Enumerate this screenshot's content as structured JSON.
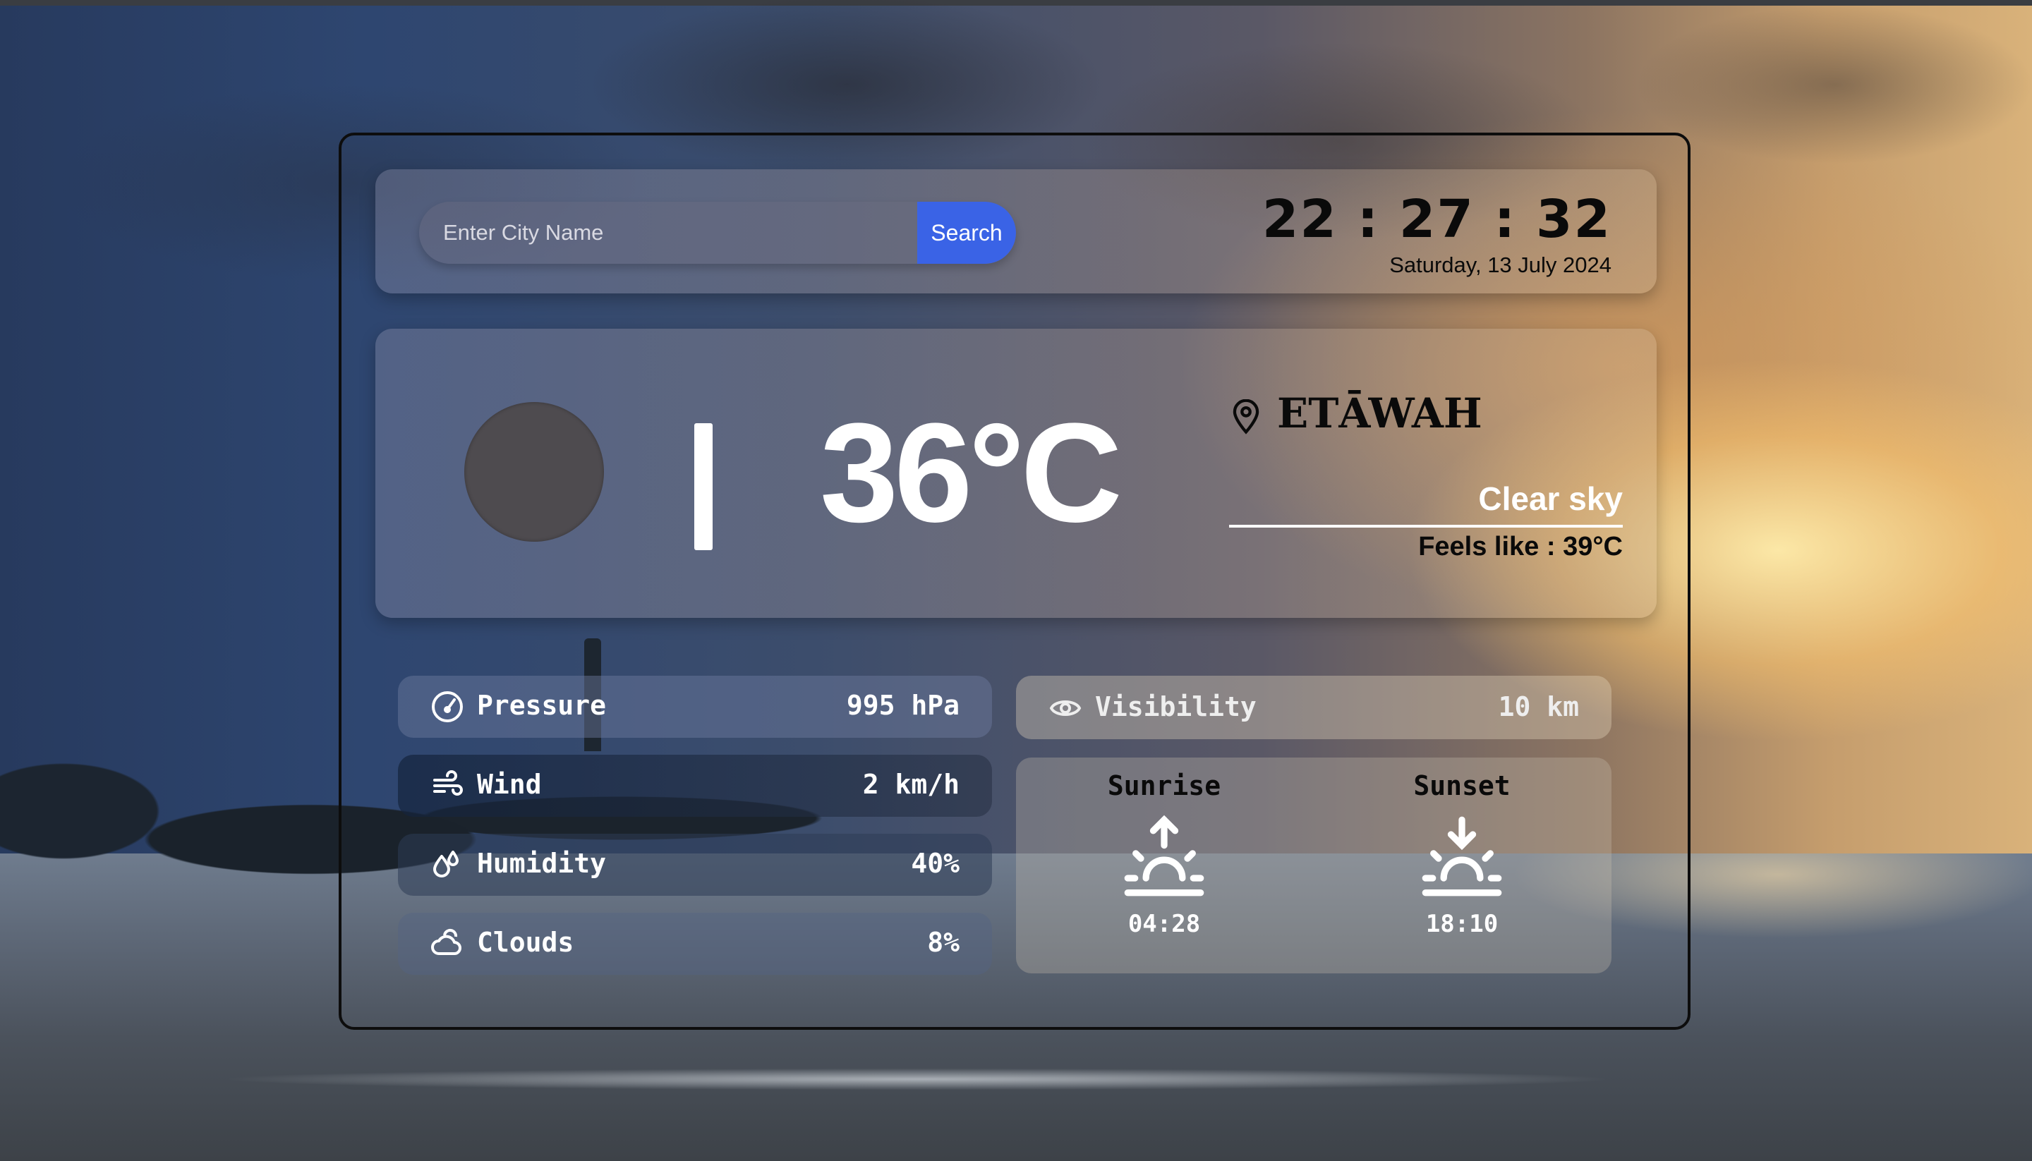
{
  "search": {
    "placeholder": "Enter City Name",
    "button_label": "Search"
  },
  "clock": {
    "time": "22 : 27 : 32",
    "date": "Saturday, 13 July 2024"
  },
  "current": {
    "temperature": "36°C",
    "separator": "|",
    "city": "ETĀWAH",
    "condition": "Clear sky",
    "feels_like": "Feels like : 39°C"
  },
  "stats": [
    {
      "label": "Pressure",
      "value": "995 hPa",
      "icon": "gauge-icon"
    },
    {
      "label": "Wind",
      "value": "2 km/h",
      "icon": "wind-icon"
    },
    {
      "label": "Humidity",
      "value": "40%",
      "icon": "droplets-icon"
    },
    {
      "label": "Clouds",
      "value": "8%",
      "icon": "cloud-icon"
    }
  ],
  "visibility": {
    "label": "Visibility",
    "value": "10 km",
    "icon": "eye-icon"
  },
  "sun": {
    "sunrise": {
      "label": "Sunrise",
      "time": "04:28",
      "icon": "sunrise-icon"
    },
    "sunset": {
      "label": "Sunset",
      "time": "18:10",
      "icon": "sunset-icon"
    }
  },
  "colors": {
    "accent": "#3a63e6",
    "text_dark": "#0a0a0a",
    "text_light": "#ffffff"
  }
}
